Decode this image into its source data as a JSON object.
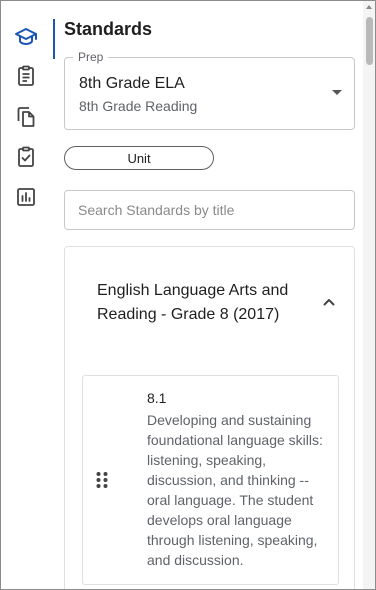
{
  "rail": {
    "items": [
      {
        "name": "graduation-cap-icon",
        "active": true
      },
      {
        "name": "clipboard-icon",
        "active": false
      },
      {
        "name": "copy-icon",
        "active": false
      },
      {
        "name": "clipboard-check-icon",
        "active": false
      },
      {
        "name": "bar-chart-icon",
        "active": false
      }
    ],
    "active_color": "#1a56b5",
    "icon_color": "#444444"
  },
  "panel": {
    "title": "Standards",
    "prep": {
      "legend": "Prep",
      "value": "8th Grade ELA",
      "subtitle": "8th Grade Reading"
    },
    "unit_label": "Unit",
    "search": {
      "placeholder": "Search Standards by title",
      "value": ""
    },
    "group": {
      "title": "English Language Arts and Reading - Grade 8 (2017)",
      "expanded": true,
      "standards": [
        {
          "code": "8.1",
          "description": "Developing and sustaining foundational language skills: listening, speaking, discussion, and thinking -- oral language. The student develops oral language through listening, speaking, and discussion."
        }
      ]
    }
  }
}
